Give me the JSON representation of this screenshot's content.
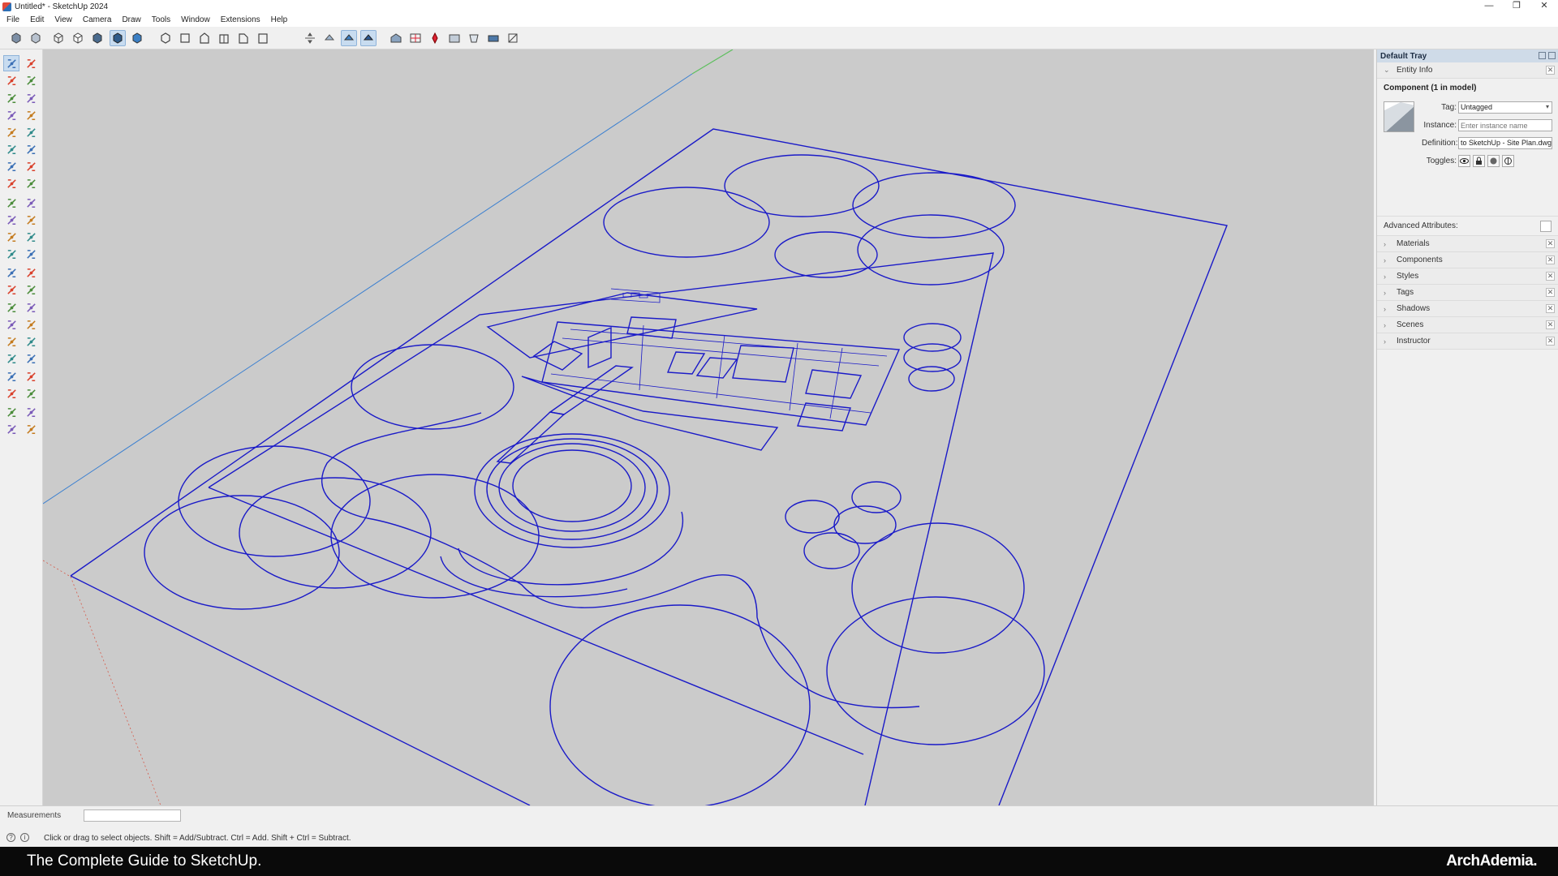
{
  "window": {
    "title": "Untitled* - SketchUp 2024",
    "min": "—",
    "restore": "❐",
    "close": "✕"
  },
  "menu": [
    "File",
    "Edit",
    "View",
    "Camera",
    "Draw",
    "Tools",
    "Window",
    "Extensions",
    "Help"
  ],
  "tray": {
    "title": "Default Tray",
    "entity_info": {
      "header": "Entity Info",
      "title": "Component (1 in model)",
      "tag_label": "Tag:",
      "tag_value": "Untagged",
      "instance_label": "Instance:",
      "instance_placeholder": "Enter instance name",
      "definition_label": "Definition:",
      "definition_value": "to SketchUp - Site Plan.dwg",
      "toggles_label": "Toggles:",
      "advanced_label": "Advanced Attributes:"
    },
    "panels": [
      "Materials",
      "Components",
      "Styles",
      "Tags",
      "Shadows",
      "Scenes",
      "Instructor"
    ]
  },
  "measurements": {
    "label": "Measurements",
    "value": ""
  },
  "status": {
    "text": "Click or drag to select objects. Shift = Add/Subtract. Ctrl = Add. Shift + Ctrl = Subtract."
  },
  "banner": {
    "left": "The Complete Guide to SketchUp.",
    "right": "ArchAdemia."
  },
  "colors": {
    "linework": "#1a1ac8",
    "viewport_bg": "#cbcbcb",
    "axis_green": "#5dbf5d",
    "axis_blue": "#3a7fd0",
    "axis_red": "#d65a4a"
  }
}
